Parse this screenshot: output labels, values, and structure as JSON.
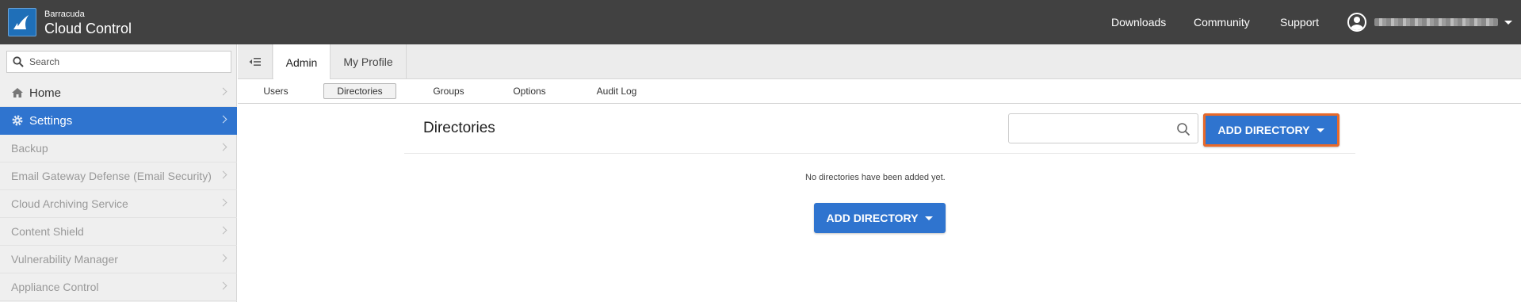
{
  "header": {
    "brand_small": "Barracuda",
    "brand_big": "Cloud Control",
    "nav": [
      {
        "label": "Downloads"
      },
      {
        "label": "Community"
      },
      {
        "label": "Support"
      }
    ]
  },
  "sidebar": {
    "search_placeholder": "Search",
    "items": [
      {
        "label": "Home"
      },
      {
        "label": "Settings"
      },
      {
        "label": "Backup"
      },
      {
        "label": "Email Gateway Defense (Email Security)"
      },
      {
        "label": "Cloud Archiving Service"
      },
      {
        "label": "Content Shield"
      },
      {
        "label": "Vulnerability Manager"
      },
      {
        "label": "Appliance Control"
      }
    ]
  },
  "tabs": [
    {
      "label": "Admin"
    },
    {
      "label": "My Profile"
    }
  ],
  "subtabs": [
    {
      "label": "Users"
    },
    {
      "label": "Directories"
    },
    {
      "label": "Groups"
    },
    {
      "label": "Options"
    },
    {
      "label": "Audit Log"
    }
  ],
  "main": {
    "title": "Directories",
    "search_value": "",
    "add_button_label": "ADD DIRECTORY",
    "empty_message": "No directories have been added yet."
  },
  "colors": {
    "header_bg": "#414141",
    "accent": "#2f74cf",
    "highlight_outline": "#e8692a",
    "sidebar_bg": "#efefef"
  }
}
